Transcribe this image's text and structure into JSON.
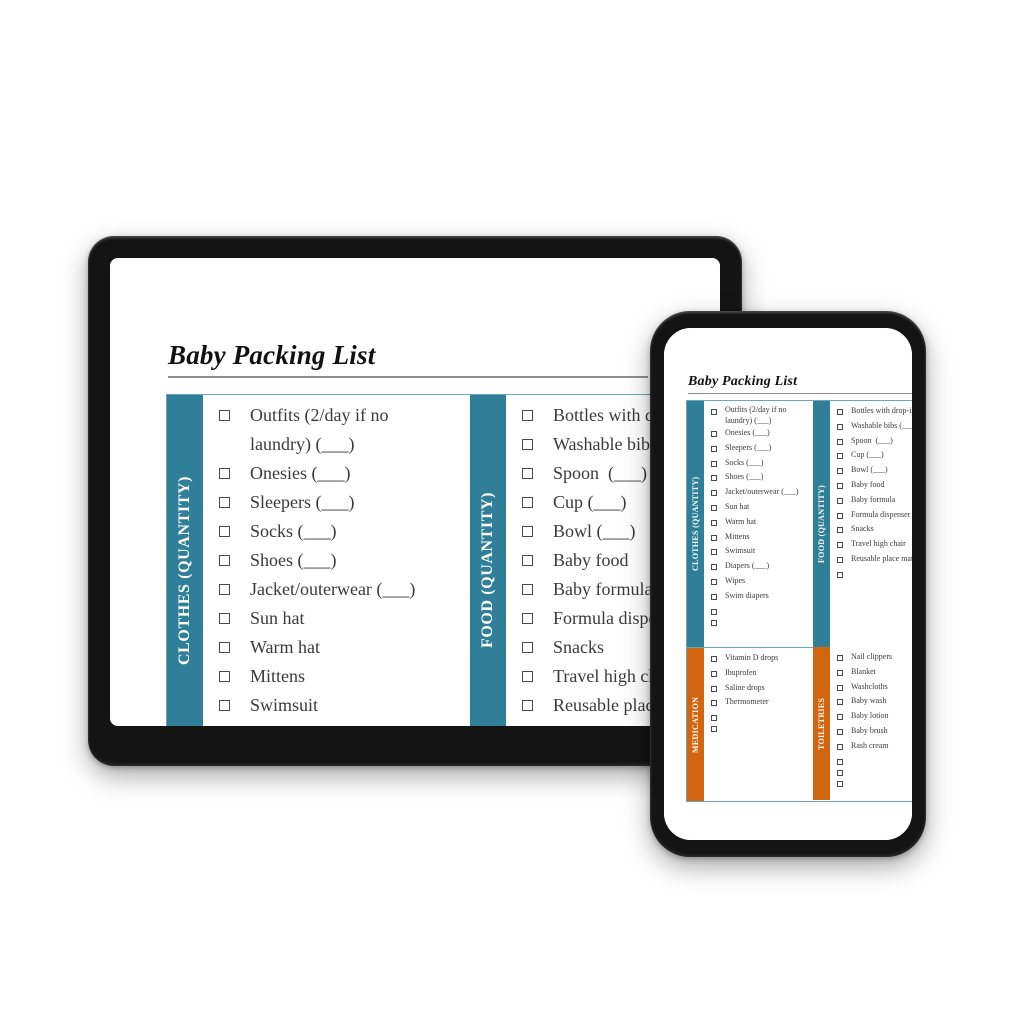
{
  "document": {
    "title": "Baby Packing List"
  },
  "colors": {
    "teal": "#2F7F99",
    "orange": "#D2650F",
    "text": "#3A3A3A",
    "rule": "#8F8F8F",
    "grid_border": "#6FA5B6",
    "device_frame": "#141414",
    "screen_bar": "#A7A7A7",
    "page_background": "#FFFFFF"
  },
  "sections": {
    "clothes": {
      "band_label": "Clothes (Quantity)",
      "band_color": "#2F7F99",
      "items": [
        "Outfits (2/day if no laundry) (___)",
        "Onesies (___)",
        "Sleepers (___)",
        "Socks (___)",
        "Shoes (___)",
        "Jacket/outerwear (___)",
        "Sun hat",
        "Warm hat",
        "Mittens",
        "Swimsuit",
        "Diapers (___)",
        "Wipes",
        "Swim diapers",
        "",
        ""
      ]
    },
    "food": {
      "band_label": "Food (Quantity)",
      "band_color": "#2F7F99",
      "items": [
        "Bottles with drop-in liners (___)",
        "Washable bibs (___)",
        "Spoon  (___)",
        "Cup (___)",
        "Bowl (___)",
        "Baby food",
        "Baby formula",
        "Formula dispenser",
        "Snacks",
        "Travel high chair",
        "Reusable place mat",
        ""
      ]
    },
    "medication": {
      "band_label": "Medication",
      "band_color": "#D2650F",
      "items": [
        "Vitamin D drops",
        "Ibuprofen",
        "Saline drops",
        "Thermometer",
        "",
        ""
      ]
    },
    "toiletries": {
      "band_label": "Toiletries",
      "band_color": "#D2650F",
      "items": [
        "Nail clippers",
        "Blanket",
        "Washcloths",
        "Baby wash",
        "Baby lotion",
        "Baby brush",
        "Rash cream",
        "",
        "",
        ""
      ]
    }
  },
  "devices": {
    "tablet": {
      "name": "tablet",
      "visible_sections": [
        "clothes",
        "food"
      ]
    },
    "phone": {
      "name": "phone",
      "visible_sections": [
        "clothes",
        "food",
        "medication",
        "toiletries"
      ]
    }
  }
}
